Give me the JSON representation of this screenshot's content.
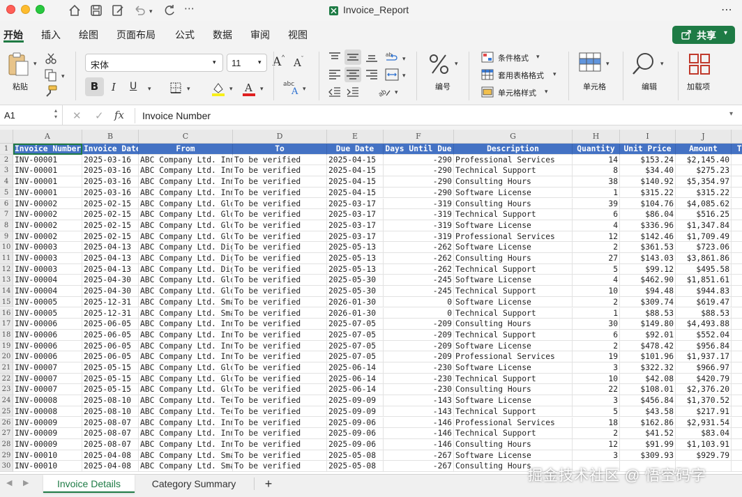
{
  "window": {
    "title": "Invoice_Report"
  },
  "tabs": [
    "开始",
    "插入",
    "绘图",
    "页面布局",
    "公式",
    "数据",
    "审阅",
    "视图"
  ],
  "share_label": "共享",
  "ribbon": {
    "paste_label": "粘贴",
    "font_name": "宋体",
    "font_size": "11",
    "font_grow": "A",
    "font_shrink": "A",
    "bold": "B",
    "italic": "I",
    "underline": "U",
    "number_label": "编号",
    "cond_format": "条件格式",
    "table_format": "套用表格格式",
    "cell_style": "单元格样式",
    "cells_label": "单元格",
    "edit_label": "编辑",
    "addins_label": "加载项"
  },
  "formula_bar": {
    "name_box": "A1",
    "content": "Invoice Number"
  },
  "columns": [
    "A",
    "B",
    "C",
    "D",
    "E",
    "F",
    "G",
    "H",
    "I",
    "J"
  ],
  "headers": [
    "Invoice Number",
    "Invoice Date",
    "From",
    "To",
    "Due Date",
    "Days Until Due",
    "Description",
    "Quantity",
    "Unit Price",
    "Amount",
    "To"
  ],
  "rows": [
    [
      "INV-00001",
      "2025-03-16",
      "ABC Company Ltd. Inn",
      "To be verified",
      "2025-04-15",
      "-290",
      "Professional Services",
      "14",
      "$153.24",
      "$2,145.40"
    ],
    [
      "INV-00001",
      "2025-03-16",
      "ABC Company Ltd. Inn",
      "To be verified",
      "2025-04-15",
      "-290",
      "Technical Support",
      "8",
      "$34.40",
      "$275.23"
    ],
    [
      "INV-00001",
      "2025-03-16",
      "ABC Company Ltd. Inn",
      "To be verified",
      "2025-04-15",
      "-290",
      "Consulting Hours",
      "38",
      "$140.92",
      "$5,354.97"
    ],
    [
      "INV-00001",
      "2025-03-16",
      "ABC Company Ltd. Inn",
      "To be verified",
      "2025-04-15",
      "-290",
      "Software License",
      "1",
      "$315.22",
      "$315.22"
    ],
    [
      "INV-00002",
      "2025-02-15",
      "ABC Company Ltd. Glo",
      "To be verified",
      "2025-03-17",
      "-319",
      "Consulting Hours",
      "39",
      "$104.76",
      "$4,085.62"
    ],
    [
      "INV-00002",
      "2025-02-15",
      "ABC Company Ltd. Glo",
      "To be verified",
      "2025-03-17",
      "-319",
      "Technical Support",
      "6",
      "$86.04",
      "$516.25"
    ],
    [
      "INV-00002",
      "2025-02-15",
      "ABC Company Ltd. Glo",
      "To be verified",
      "2025-03-17",
      "-319",
      "Software License",
      "4",
      "$336.96",
      "$1,347.84"
    ],
    [
      "INV-00002",
      "2025-02-15",
      "ABC Company Ltd. Glo",
      "To be verified",
      "2025-03-17",
      "-319",
      "Professional Services",
      "12",
      "$142.46",
      "$1,709.49"
    ],
    [
      "INV-00003",
      "2025-04-13",
      "ABC Company Ltd. Dig",
      "To be verified",
      "2025-05-13",
      "-262",
      "Software License",
      "2",
      "$361.53",
      "$723.06"
    ],
    [
      "INV-00003",
      "2025-04-13",
      "ABC Company Ltd. Dig",
      "To be verified",
      "2025-05-13",
      "-262",
      "Consulting Hours",
      "27",
      "$143.03",
      "$3,861.86"
    ],
    [
      "INV-00003",
      "2025-04-13",
      "ABC Company Ltd. Dig",
      "To be verified",
      "2025-05-13",
      "-262",
      "Technical Support",
      "5",
      "$99.12",
      "$495.58"
    ],
    [
      "INV-00004",
      "2025-04-30",
      "ABC Company Ltd. Glo",
      "To be verified",
      "2025-05-30",
      "-245",
      "Software License",
      "4",
      "$462.90",
      "$1,851.61"
    ],
    [
      "INV-00004",
      "2025-04-30",
      "ABC Company Ltd. Glo",
      "To be verified",
      "2025-05-30",
      "-245",
      "Technical Support",
      "10",
      "$94.48",
      "$944.83"
    ],
    [
      "INV-00005",
      "2025-12-31",
      "ABC Company Ltd. Sma",
      "To be verified",
      "2026-01-30",
      "0",
      "Software License",
      "2",
      "$309.74",
      "$619.47"
    ],
    [
      "INV-00005",
      "2025-12-31",
      "ABC Company Ltd. Sma",
      "To be verified",
      "2026-01-30",
      "0",
      "Technical Support",
      "1",
      "$88.53",
      "$88.53"
    ],
    [
      "INV-00006",
      "2025-06-05",
      "ABC Company Ltd. Inn",
      "To be verified",
      "2025-07-05",
      "-209",
      "Consulting Hours",
      "30",
      "$149.80",
      "$4,493.88"
    ],
    [
      "INV-00006",
      "2025-06-05",
      "ABC Company Ltd. Inn",
      "To be verified",
      "2025-07-05",
      "-209",
      "Technical Support",
      "6",
      "$92.01",
      "$552.04"
    ],
    [
      "INV-00006",
      "2025-06-05",
      "ABC Company Ltd. Inn",
      "To be verified",
      "2025-07-05",
      "-209",
      "Software License",
      "2",
      "$478.42",
      "$956.84"
    ],
    [
      "INV-00006",
      "2025-06-05",
      "ABC Company Ltd. Inn",
      "To be verified",
      "2025-07-05",
      "-209",
      "Professional Services",
      "19",
      "$101.96",
      "$1,937.17"
    ],
    [
      "INV-00007",
      "2025-05-15",
      "ABC Company Ltd. Glo",
      "To be verified",
      "2025-06-14",
      "-230",
      "Software License",
      "3",
      "$322.32",
      "$966.97"
    ],
    [
      "INV-00007",
      "2025-05-15",
      "ABC Company Ltd. Glo",
      "To be verified",
      "2025-06-14",
      "-230",
      "Technical Support",
      "10",
      "$42.08",
      "$420.79"
    ],
    [
      "INV-00007",
      "2025-05-15",
      "ABC Company Ltd. Glo",
      "To be verified",
      "2025-06-14",
      "-230",
      "Consulting Hours",
      "22",
      "$108.01",
      "$2,376.20"
    ],
    [
      "INV-00008",
      "2025-08-10",
      "ABC Company Ltd. Tec",
      "To be verified",
      "2025-09-09",
      "-143",
      "Software License",
      "3",
      "$456.84",
      "$1,370.52"
    ],
    [
      "INV-00008",
      "2025-08-10",
      "ABC Company Ltd. Tec",
      "To be verified",
      "2025-09-09",
      "-143",
      "Technical Support",
      "5",
      "$43.58",
      "$217.91"
    ],
    [
      "INV-00009",
      "2025-08-07",
      "ABC Company Ltd. Inn",
      "To be verified",
      "2025-09-06",
      "-146",
      "Professional Services",
      "18",
      "$162.86",
      "$2,931.54"
    ],
    [
      "INV-00009",
      "2025-08-07",
      "ABC Company Ltd. Inn",
      "To be verified",
      "2025-09-06",
      "-146",
      "Technical Support",
      "2",
      "$41.52",
      "$83.04"
    ],
    [
      "INV-00009",
      "2025-08-07",
      "ABC Company Ltd. Inn",
      "To be verified",
      "2025-09-06",
      "-146",
      "Consulting Hours",
      "12",
      "$91.99",
      "$1,103.91"
    ],
    [
      "INV-00010",
      "2025-04-08",
      "ABC Company Ltd. Sma",
      "To be verified",
      "2025-05-08",
      "-267",
      "Software License",
      "3",
      "$309.93",
      "$929.79"
    ],
    [
      "INV-00010",
      "2025-04-08",
      "ABC Company Ltd. Sma",
      "To be verified",
      "2025-05-08",
      "-267",
      "Consulting Hours",
      "",
      "",
      ""
    ]
  ],
  "sheets": [
    "Invoice Details",
    "Category Summary"
  ],
  "add_sheet": "+",
  "watermark": "掘金技术社区 @ 悟空码字",
  "accent_color": "#1e7b45",
  "header_fill": "#4472c4"
}
